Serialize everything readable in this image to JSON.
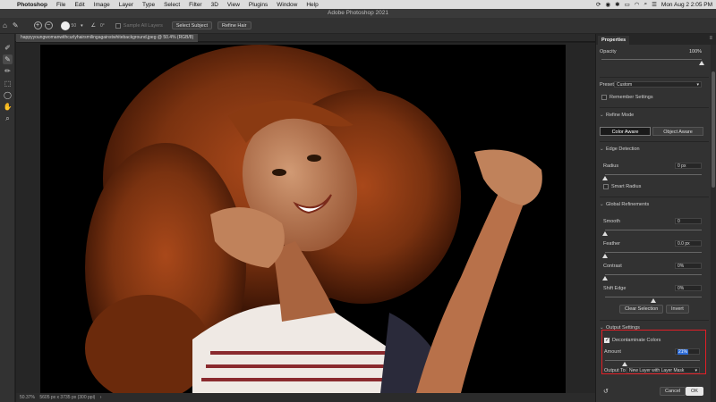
{
  "menubar": {
    "app": "Photoshop",
    "items": [
      "File",
      "Edit",
      "Image",
      "Layer",
      "Type",
      "Select",
      "Filter",
      "3D",
      "View",
      "Plugins",
      "Window",
      "Help"
    ],
    "datetime": "Mon Aug 2  2:05 PM"
  },
  "window": {
    "title": "Adobe Photoshop 2021"
  },
  "options_bar": {
    "brush_size": "50",
    "angle": "0°",
    "sample_all_layers": "Sample All Layers",
    "select_subject": "Select Subject",
    "refine_hair": "Refine Hair"
  },
  "document": {
    "tab_title": "happyyoungwomanwithcurlyhairsmilingagainstwhitebackground.jpeg @ 50.4% (RGB/8)"
  },
  "status": {
    "zoom": "50.37%",
    "dimensions": "5605 px x 3735 px (300 ppi)"
  },
  "properties": {
    "tab": "Properties",
    "opacity_label": "Opacity",
    "opacity_value": "100%",
    "preset_label": "Preset",
    "preset_value": "Custom",
    "remember_settings": "Remember Settings",
    "refine_mode": {
      "title": "Refine Mode",
      "color_aware": "Color Aware",
      "object_aware": "Object Aware"
    },
    "edge_detection": {
      "title": "Edge Detection",
      "radius_label": "Radius",
      "radius_value": "0 px",
      "smart_radius": "Smart Radius"
    },
    "global_refinements": {
      "title": "Global Refinements",
      "smooth_label": "Smooth",
      "smooth_value": "0",
      "feather_label": "Feather",
      "feather_value": "0.0 px",
      "contrast_label": "Contrast",
      "contrast_value": "0%",
      "shift_edge_label": "Shift Edge",
      "shift_edge_value": "0%",
      "clear_selection": "Clear Selection",
      "invert": "Invert"
    },
    "output_settings": {
      "title": "Output Settings",
      "decontaminate_colors": "Decontaminate Colors",
      "amount_label": "Amount",
      "amount_value": "21%",
      "output_to_label": "Output To",
      "output_to_value": "New Layer with Layer Mask"
    },
    "cancel": "Cancel",
    "ok": "OK"
  },
  "levels": {
    "opacity": 1.0,
    "radius": 0.0,
    "smooth": 0.0,
    "feather": 0.0,
    "contrast": 0.0,
    "shift_edge": 0.5,
    "amount": 0.21
  },
  "colors": {
    "highlight": "#e21f26",
    "panel_bg": "#323232",
    "hair": "#8a3a12",
    "skin": "#b8714a"
  }
}
